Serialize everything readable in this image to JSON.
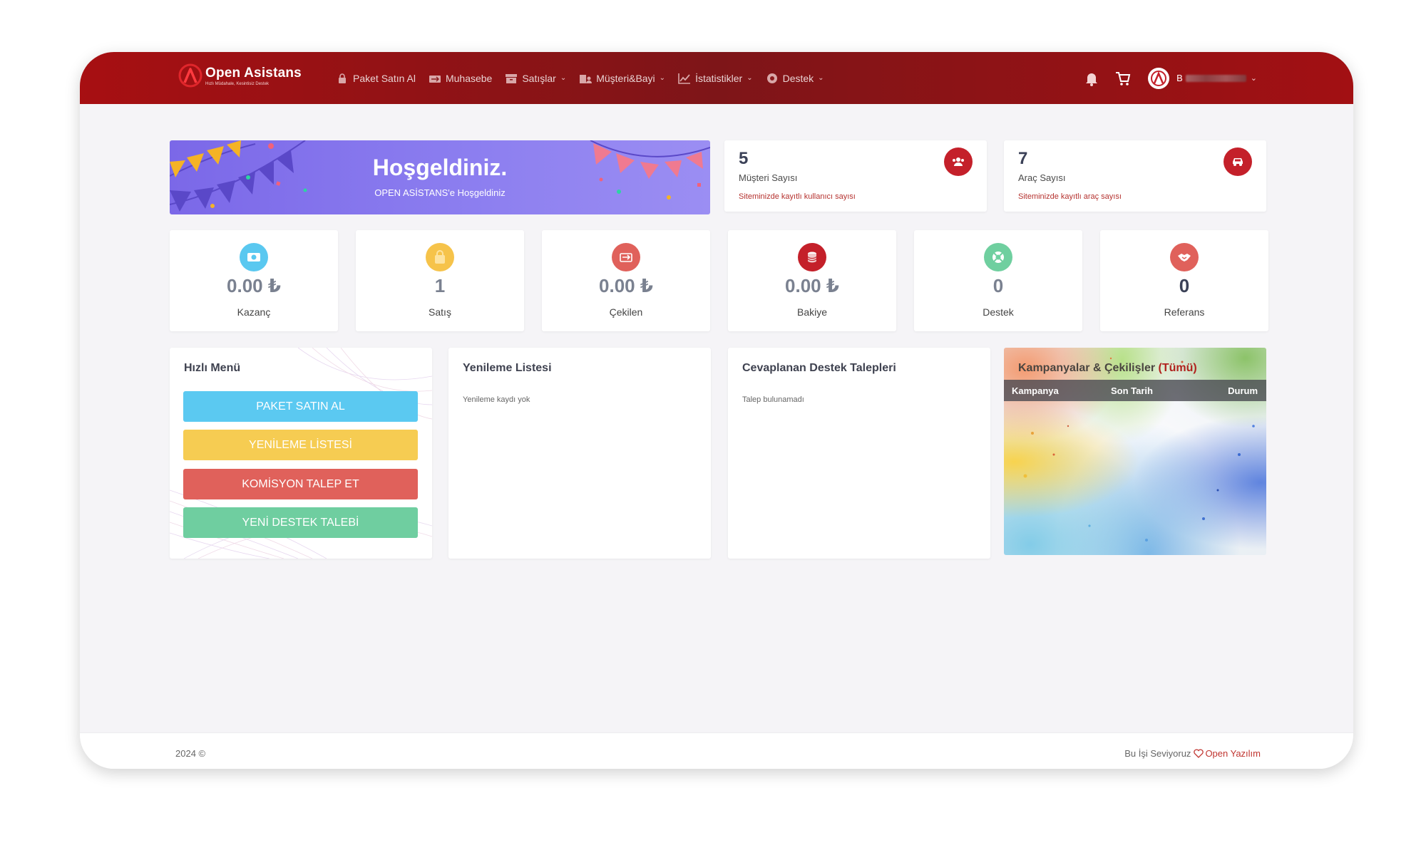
{
  "app": {
    "logo_title": "Open Asistans",
    "logo_tagline": "Hızlı Müdahale, Kesintisiz Destek"
  },
  "nav": {
    "items": [
      {
        "label": "Paket Satın Al",
        "icon": "lock-icon",
        "has_dropdown": false
      },
      {
        "label": "Muhasebe",
        "icon": "exchange-icon",
        "has_dropdown": false
      },
      {
        "label": "Satışlar",
        "icon": "box-icon",
        "has_dropdown": true
      },
      {
        "label": "Müşteri&Bayi",
        "icon": "building-user-icon",
        "has_dropdown": true
      },
      {
        "label": "İstatistikler",
        "icon": "chart-icon",
        "has_dropdown": true
      },
      {
        "label": "Destek",
        "icon": "lifebuoy-icon",
        "has_dropdown": true
      }
    ],
    "user_initial": "B"
  },
  "welcome": {
    "title": "Hoşgeldiniz.",
    "subtitle": "OPEN ASİSTANS'e Hoşgeldiniz"
  },
  "stats": [
    {
      "value": "5",
      "label": "Müşteri Sayısı",
      "sub": "Siteminizde kayıtlı kullanıcı sayısı",
      "icon": "users-icon"
    },
    {
      "value": "7",
      "label": "Araç Sayısı",
      "sub": "Siteminizde kayıtlı araç sayısı",
      "icon": "car-icon"
    }
  ],
  "mini_cards": [
    {
      "value": "0.00 ₺",
      "label": "Kazanç",
      "icon": "money-icon",
      "color": "#5ac8f0"
    },
    {
      "value": "1",
      "label": "Satış",
      "icon": "bag-icon",
      "color": "#f6c34a"
    },
    {
      "value": "0.00 ₺",
      "label": "Çekilen",
      "icon": "transfer-icon",
      "color": "#e0615b"
    },
    {
      "value": "0.00 ₺",
      "label": "Bakiye",
      "icon": "coins-icon",
      "color": "#c4202a"
    },
    {
      "value": "0",
      "label": "Destek",
      "icon": "lifebuoy-icon",
      "color": "#6fcf9f"
    },
    {
      "value": "0",
      "label": "Referans",
      "icon": "handshake-icon",
      "color": "#e0615b"
    }
  ],
  "quick_menu": {
    "title": "Hızlı Menü",
    "buttons": [
      {
        "label": "PAKET SATIN AL",
        "color": "#5bc9f1"
      },
      {
        "label": "YENİLEME LİSTESİ",
        "color": "#f6cc52"
      },
      {
        "label": "KOMİSYON TALEP ET",
        "color": "#e0615b"
      },
      {
        "label": "YENİ DESTEK TALEBİ",
        "color": "#6fcea0"
      }
    ]
  },
  "renewals": {
    "title": "Yenileme Listesi",
    "empty": "Yenileme kaydı yok"
  },
  "support": {
    "title": "Cevaplanan Destek Talepleri",
    "empty": "Talep bulunamadı"
  },
  "campaigns": {
    "title": "Kampanyalar & Çekilişler",
    "all_link": "(Tümü)",
    "columns": [
      "Kampanya",
      "Son Tarih",
      "Durum"
    ]
  },
  "footer": {
    "copyright": "2024 ©",
    "love_text": "Bu İşi Seviyoruz",
    "brand": "Open Yazılım"
  },
  "colors": {
    "brand_red": "#a70f12",
    "welcome_purple": "#7b68e8"
  }
}
